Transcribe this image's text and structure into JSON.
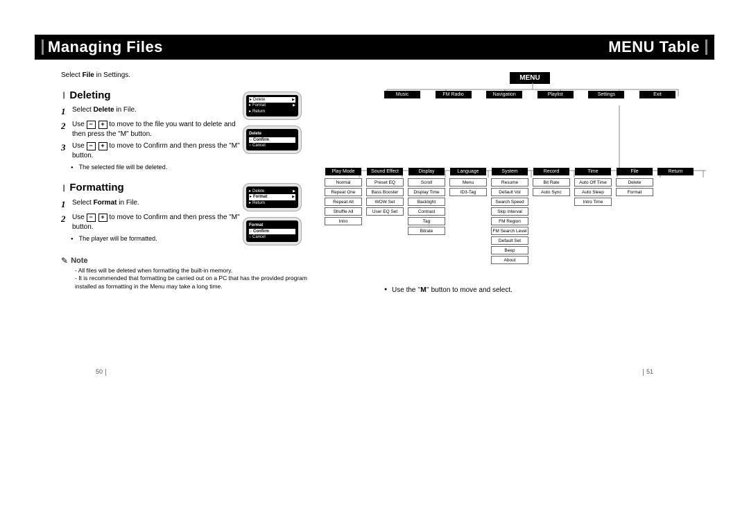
{
  "header": {
    "left_title": "Managing Files",
    "right_title": "MENU Table"
  },
  "left_page": {
    "intro_prefix": "Select ",
    "intro_bold": "File",
    "intro_suffix": " in Settings.",
    "deleting": {
      "title": "Deleting",
      "step1_prefix": "Select ",
      "step1_bold": "Delete",
      "step1_suffix": " in File.",
      "step2_before": "Use ",
      "step2_after": " to move to the file you want to delete and then press the \"M\" button.",
      "step3_before": "Use ",
      "step3_after": " to move to Confirm and then press the \"M\" button.",
      "bullet": "The selected file will be deleted."
    },
    "formatting": {
      "title": "Formatting",
      "step1_prefix": "Select ",
      "step1_bold": "Format",
      "step1_suffix": " in File.",
      "step2_before": "Use ",
      "step2_after": " to move to Confirm and then press the \"M\" button.",
      "bullet": "The player will be formatted."
    },
    "note": {
      "label": "Note",
      "line1": "- All files will be deleted when formatting the built-in memory.",
      "line2": "- It is recommended that formatting be carried out on a PC that has the provided program installed as formatting in the Menu may take a long time."
    },
    "lcd": {
      "delete_menu": [
        "Delete",
        "Format",
        "Return"
      ],
      "delete_confirm_title": "Delete",
      "confirm": "Confirm",
      "cancel": "Cancel",
      "format_menu": [
        "Delete",
        "Format",
        "Return"
      ],
      "format_confirm_title": "Format"
    }
  },
  "right_page": {
    "menu_label": "MENU",
    "top_row": [
      "Music",
      "FM Radio",
      "Navigation",
      "Playlist",
      "Settings",
      "Exit"
    ],
    "settings_cols": {
      "Play Mode": [
        "Normal",
        "Repeat One",
        "Repeat All",
        "Shuffle All",
        "Intro"
      ],
      "Sound Effect": [
        "Preset EQ",
        "Bass Booster",
        "WOW Set",
        "User EQ Set"
      ],
      "Display": [
        "Scroll",
        "Display Time",
        "Backlight",
        "Contrast",
        "Tag",
        "Bitrate"
      ],
      "Language": [
        "Menu",
        "ID3-Tag"
      ],
      "System": [
        "Resume",
        "Default Vol",
        "Search Speed",
        "Skip Interval",
        "FM Region",
        "FM Search Level",
        "Default Set",
        "Beep",
        "About"
      ],
      "Record": [
        "Bit Rate",
        "Auto Sync"
      ],
      "Time": [
        "Auto Off Time",
        "Auto Sleep",
        "Intro Time"
      ],
      "File": [
        "Delete",
        "Format"
      ],
      "Return": []
    },
    "use_note_before": "Use the ",
    "use_note_q1": "\"",
    "use_note_m": "M",
    "use_note_q2": "\"",
    "use_note_after": " button to move and select."
  },
  "page_numbers": {
    "left": "50",
    "right": "51"
  }
}
